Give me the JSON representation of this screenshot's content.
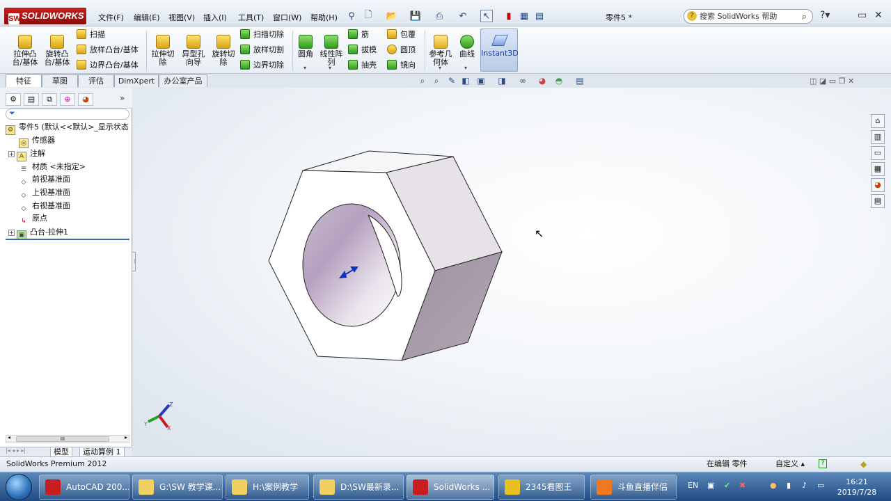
{
  "app": {
    "logo_text": "SOLIDWORKS",
    "document_title": "零件5 *"
  },
  "menu": [
    "文件(F)",
    "编辑(E)",
    "视图(V)",
    "插入(I)",
    "工具(T)",
    "窗口(W)",
    "帮助(H)"
  ],
  "search": {
    "placeholder": "搜索 SolidWorks 帮助"
  },
  "commands": {
    "extrude_boss": "拉伸凸\n台/基体",
    "revolve_boss": "旋转凸\n台/基体",
    "sweep": "扫描",
    "loft_boss": "放样凸台/基体",
    "boundary_boss": "边界凸台/基体",
    "extrude_cut": "拉伸切\n除",
    "hole_wizard": "异型孔\n向导",
    "revolve_cut": "旋转切\n除",
    "swept_cut": "扫描切除",
    "lofted_cut": "放样切割",
    "boundary_cut": "边界切除",
    "fillet": "圆角",
    "linear_pattern": "线性阵\n列",
    "rib": "筋",
    "draft": "拔模",
    "shell": "抽壳",
    "wrap": "包覆",
    "dome": "圆顶",
    "mirror": "镜向",
    "reference_geometry": "参考几\n何体",
    "curves": "曲线",
    "instant3d": "Instant3D"
  },
  "tabs": [
    "特征",
    "草图",
    "评估",
    "DimXpert",
    "办公室产品"
  ],
  "feature_tree": {
    "root": "零件5 (默认<<默认>_显示状态",
    "items": [
      "传感器",
      "注解",
      "材质 <未指定>",
      "前视基准面",
      "上视基准面",
      "右视基准面",
      "原点",
      "凸台-拉伸1"
    ]
  },
  "bottom_tabs": [
    "模型",
    "运动算例 1"
  ],
  "scrollbar_grip": "III",
  "status": {
    "left": "SolidWorks Premium 2012",
    "editing": "在编辑 零件",
    "custom": "自定义 ▴"
  },
  "triad": {
    "x": "X",
    "y": "Y",
    "z": "Z"
  },
  "taskbar": {
    "items": [
      "AutoCAD 200...",
      "G:\\SW 教学课...",
      "H:\\案例教学",
      "D:\\SW最新录...",
      "SolidWorks ...",
      "2345看图王",
      "斗鱼直播伴侣"
    ],
    "lang": "EN",
    "time": "16:21",
    "date": "2019/7/28"
  },
  "colors": {
    "face_light": "#f4f4f6",
    "face_right": "#e6e1e6",
    "face_dark": "#a89aa8",
    "accent": "#1f4b82"
  }
}
